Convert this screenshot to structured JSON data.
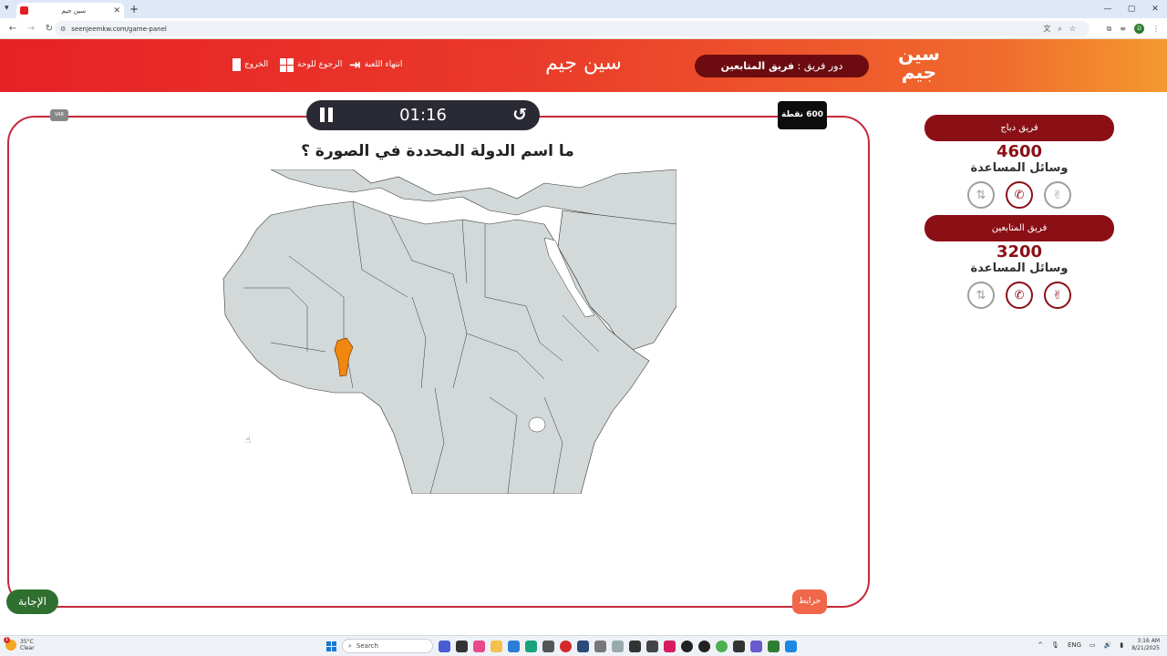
{
  "browser": {
    "tab_title": "سين جيم",
    "tab_close": "✕",
    "new_tab": "+",
    "tab_menu": "▾",
    "url": "seenjeemkw.com/game-panel",
    "window_controls": [
      "—",
      "▢",
      "✕"
    ]
  },
  "header": {
    "logo_text": "سين جيم",
    "turn_prefix": "دور فريق : ",
    "turn_team": "فريق المتابعين",
    "brand": "سين جيم",
    "end_game": "انتهاء اللعبة",
    "back_to_board": "الرجوع للوحة",
    "exit": "الخروج"
  },
  "game": {
    "timer": "01:16",
    "points": "600 نقطة",
    "var_badge": "VAR",
    "question": "ما اسم الدولة المحددة في الصورة ؟",
    "answer_button": "الإجابة",
    "maps_button": "خرايط",
    "highlighted_color": "#f2870f",
    "map_land_color": "#d3d9d9"
  },
  "teams": [
    {
      "name": "فريق دباج",
      "score": "4600",
      "aids_label": "وسائل المساعدة"
    },
    {
      "name": "فريق المتابعين",
      "score": "3200",
      "aids_label": "وسائل المساعدة"
    }
  ],
  "taskbar": {
    "temp": "35°C",
    "condition": "Clear",
    "weather_badge": "1",
    "search": "Search",
    "lang": "ENG",
    "time": "3:16 AM",
    "date": "8/21/2025"
  }
}
